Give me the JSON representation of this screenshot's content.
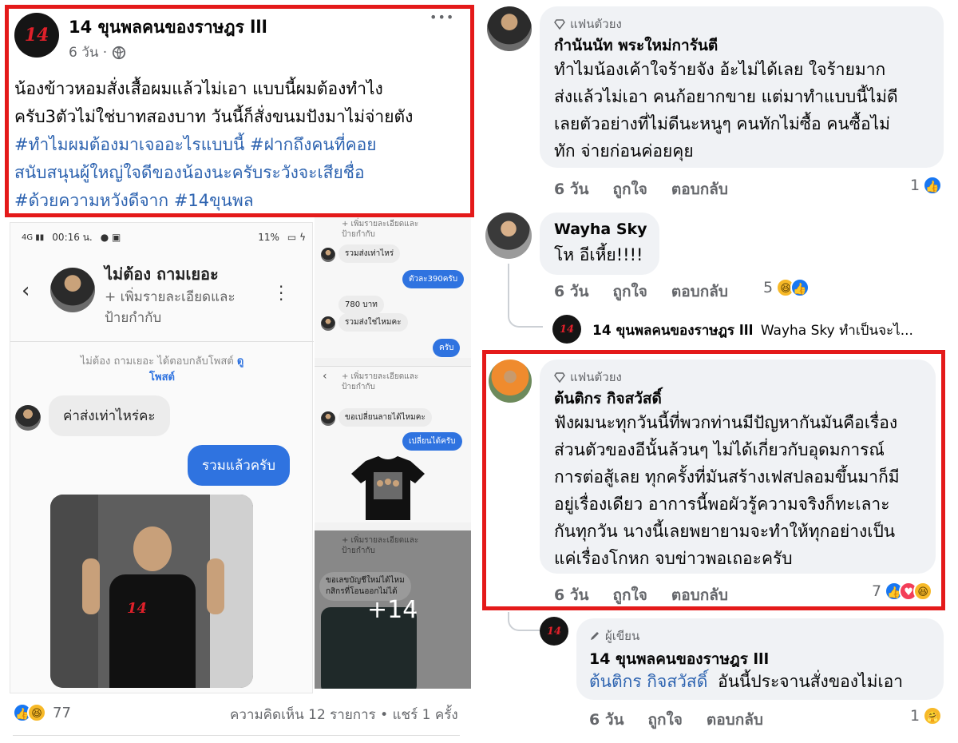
{
  "post": {
    "page_name": "14 ขุนพลคนของราษฎร lll",
    "time": "6 วัน ·",
    "more": "•••",
    "text_line1": "น้องข้าวหอมสั่งเสื้อผมแล้วไม่เอา แบบนี้ผมต้องทำไง",
    "text_line2": "ครับ3ตัวไม่ใช่บาทสองบาท วันนี้ก็สั่งขนมปังมาไม่จ่ายตัง",
    "hashtag_line1": "#ทำไมผมต้องมาเจออะไรแบบนี้  #ฝากถึงคนที่คอย",
    "hashtag_line2": "สนับสนุนผู้ใหญ่ใจดีของน้องนะครับระวังจะเสียชื่อ",
    "hashtag_line3": "#ด้วยความหวังดีจาก #14ขุนพล",
    "reaction_count": "77",
    "comments_shares": "ความคิดเห็น 12 รายการ • แชร์ 1 ครั้ง"
  },
  "messenger": {
    "status_time": "00:16 น.",
    "status_battery": "11%",
    "contact_name": "ไม่ต้อง ถามเยอะ",
    "contact_sub1": "+ เพิ่มรายละเอียดและ",
    "contact_sub2": "ป้ายกำกับ",
    "reply_notice": "ไม่ต้อง ถามเยอะ ได้ตอบกลับโพสต์",
    "reply_link1": "ดู",
    "reply_link2": "โพสต์",
    "msg_in": "ค่าส่งเท่าไหร่คะ",
    "msg_out": "รวมแล้วครับ"
  },
  "thumbs": {
    "t1_sub1": "+ เพิ่มรายละเอียดและ",
    "t1_sub2": "ป้ายกำกับ",
    "t1_in1": "รวมส่งเท่าไหร่",
    "t1_out1": "ตัวละ390ครับ",
    "t1_in2": "780 บาท",
    "t1_in3": "รวมส่งใช่ไหมคะ",
    "t1_out2": "ครับ",
    "t2_sub1": "+ เพิ่มรายละเอียดและ",
    "t2_sub2": "ป้ายกำกับ",
    "t2_in1": "ขอเปลี่ยนลายได้ไหมคะ",
    "t2_out1": "เปลี่ยนได้ครับ",
    "t3_sub1": "+ เพิ่มรายละเอียดและ",
    "t3_sub2": "ป้ายกำกับ",
    "t3_in1a": "ขอเลขบัญชีใหม่ได้ไหม",
    "t3_in1b": "กสิกรที่โอนออกไม่ได้",
    "more_count": "+14"
  },
  "comments": {
    "c1_badge": "แฟนตัวยง",
    "c1_name": "กำนันนัท พระใหม่การันตี",
    "c1_line1": "ทำไมน้องเค้าใจร้ายจัง อ้ะไม่ได้เลย ใจร้ายมาก",
    "c1_line2": "ส่งแล้วไม่เอา คนก้อยากขาย แต่มาทำแบบนี้ไม่ดี",
    "c1_line3": "เลยตัวอย่างที่ไม่ดีนะหนูๆ คนทักไม่ซื้อ คนซื้อไม่",
    "c1_line4": "ทัก จ่ายก่อนค่อยคุย",
    "c1_time": "6 วัน",
    "c1_like": "ถูกใจ",
    "c1_reply": "ตอบกลับ",
    "c1_count": "1",
    "c2_name": "Wayha Sky",
    "c2_text": "โห อีเหี้ย!!!!",
    "c2_time": "6 วัน",
    "c2_like": "ถูกใจ",
    "c2_reply": "ตอบกลับ",
    "c2_count": "5",
    "c2_sub_name": "14 ขุนพลคนของราษฎร lll",
    "c2_sub_text": "Wayha Sky ทำเป็นจะไ...",
    "c3_badge": "แฟนตัวยง",
    "c3_name": "ต้นติกร กิจสวัสดิ์",
    "c3_line1": "ฟังผมนะทุกวันนี้ที่พวกท่านมีปัญหากันมันคือเรื่อง",
    "c3_line2": "ส่วนตัวของอีนั้นล้วนๆ ไม่ได้เกี่ยวกับอุดมการณ์",
    "c3_line3": "การต่อสู้เลย ทุกครั้งที่มันสร้างเฟสปลอมขึ้นมาก็มี",
    "c3_line4": "อยู่เรื่องเดียว อาการนี้พอผัวรู้ความจริงก็ทะเลาะ",
    "c3_line5": "กันทุกวัน นางนี้เลยพยายามจะทำให้ทุกอย่างเป็น",
    "c3_line6": "แค่เรื่องโกหก จบข่าวพอเถอะครับ",
    "c3_time": "6 วัน",
    "c3_like": "ถูกใจ",
    "c3_reply": "ตอบกลับ",
    "c3_count": "7",
    "c4_badge": "ผู้เขียน",
    "c4_name": "14 ขุนพลคนของราษฎร lll",
    "c4_mention": "ต้นติกร กิจสวัสดิ์",
    "c4_text": "อันนี้ประจานสั่งของไม่เอา",
    "c4_time": "6 วัน",
    "c4_like": "ถูกใจ",
    "c4_reply": "ตอบกลับ",
    "c4_count": "1"
  },
  "colors": {
    "highlight_red": "#e41a1a",
    "hashtag_blue": "#2d63b0",
    "messenger_blue": "#2f73e0",
    "bubble_gray": "#f0f2f5"
  }
}
